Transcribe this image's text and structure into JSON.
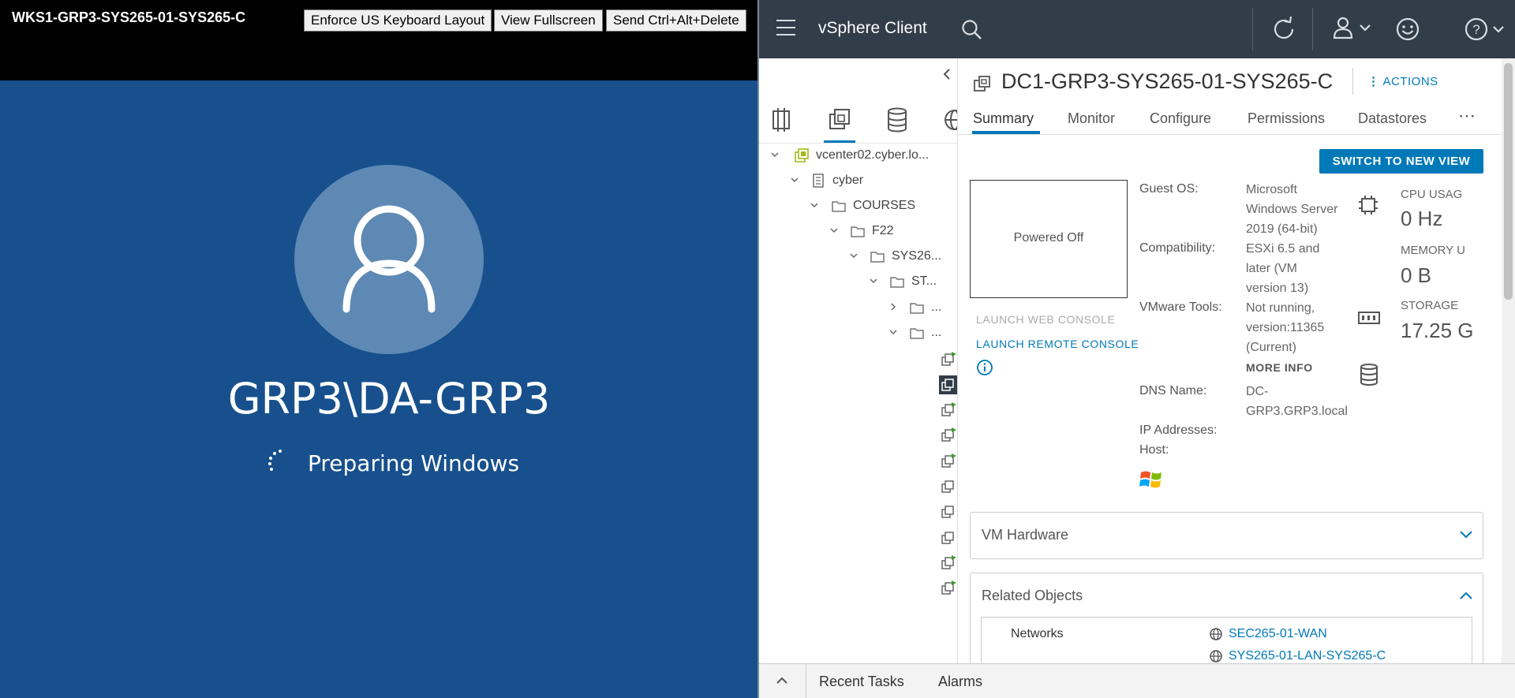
{
  "console": {
    "window_title": "WKS1-GRP3-SYS265-01-SYS265-C",
    "buttons": {
      "keyboard": "Enforce US Keyboard Layout",
      "fullscreen": "View Fullscreen",
      "ctrl_alt_del": "Send Ctrl+Alt+Delete"
    },
    "username": "GRP3\\DA-GRP3",
    "status_text": "Preparing Windows",
    "background_color": "#17508d"
  },
  "vsphere": {
    "app_title": "vSphere Client",
    "header_color": "#313d48",
    "accent_color": "#0079b8",
    "header_icons": [
      "menu-icon",
      "search-icon",
      "refresh-icon",
      "user-icon",
      "smiley-icon",
      "help-icon"
    ],
    "navigator": {
      "tab_icons": [
        "hosts-clusters-icon",
        "vms-templates-icon",
        "storage-icon",
        "networking-icon"
      ],
      "tree": [
        {
          "label": "vcenter02.cyber.lo..."
        },
        {
          "label": "cyber"
        },
        {
          "label": "COURSES"
        },
        {
          "label": "F22"
        },
        {
          "label": "SYS26..."
        },
        {
          "label": "ST..."
        },
        {
          "label": "..."
        },
        {
          "label": "..."
        }
      ]
    },
    "vm": {
      "title": "DC1-GRP3-SYS265-01-SYS265-C",
      "actions_label": "ACTIONS",
      "tabs": [
        "Summary",
        "Monitor",
        "Configure",
        "Permissions",
        "Datastores"
      ],
      "more_tabs": "⋯",
      "switch_button": "SWITCH TO NEW VIEW",
      "screen_status": "Powered Off",
      "launch_web_console": "LAUNCH WEB CONSOLE",
      "launch_remote_console": "LAUNCH REMOTE CONSOLE",
      "info": {
        "guest_os_label": "Guest OS:",
        "guest_os_value": [
          "Microsoft",
          "Windows Server",
          "2019 (64-bit)"
        ],
        "compat_label": "Compatibility:",
        "compat_value": [
          "ESXi 6.5 and",
          "later (VM",
          "version 13)"
        ],
        "tools_label": "VMware Tools:",
        "tools_value": [
          "Not running,",
          "version:11365",
          "(Current)"
        ],
        "more_info": "MORE INFO",
        "dns_label": "DNS Name:",
        "dns_value": [
          "DC-",
          "GRP3.GRP3.local"
        ],
        "ip_label": "IP Addresses:",
        "host_label": "Host:"
      },
      "metrics": {
        "cpu_label": "CPU USAG",
        "cpu_value": "0 Hz",
        "mem_label": "MEMORY U",
        "mem_value": "0 B",
        "storage_label": "STORAGE",
        "storage_value": "17.25 G"
      },
      "panels": {
        "hardware": "VM Hardware",
        "related": "Related Objects",
        "networks_label": "Networks",
        "networks": [
          "SEC265-01-WAN",
          "SYS265-01-LAN-SYS265-C"
        ]
      }
    },
    "bottom": {
      "recent_tasks": "Recent Tasks",
      "alarms": "Alarms"
    }
  }
}
